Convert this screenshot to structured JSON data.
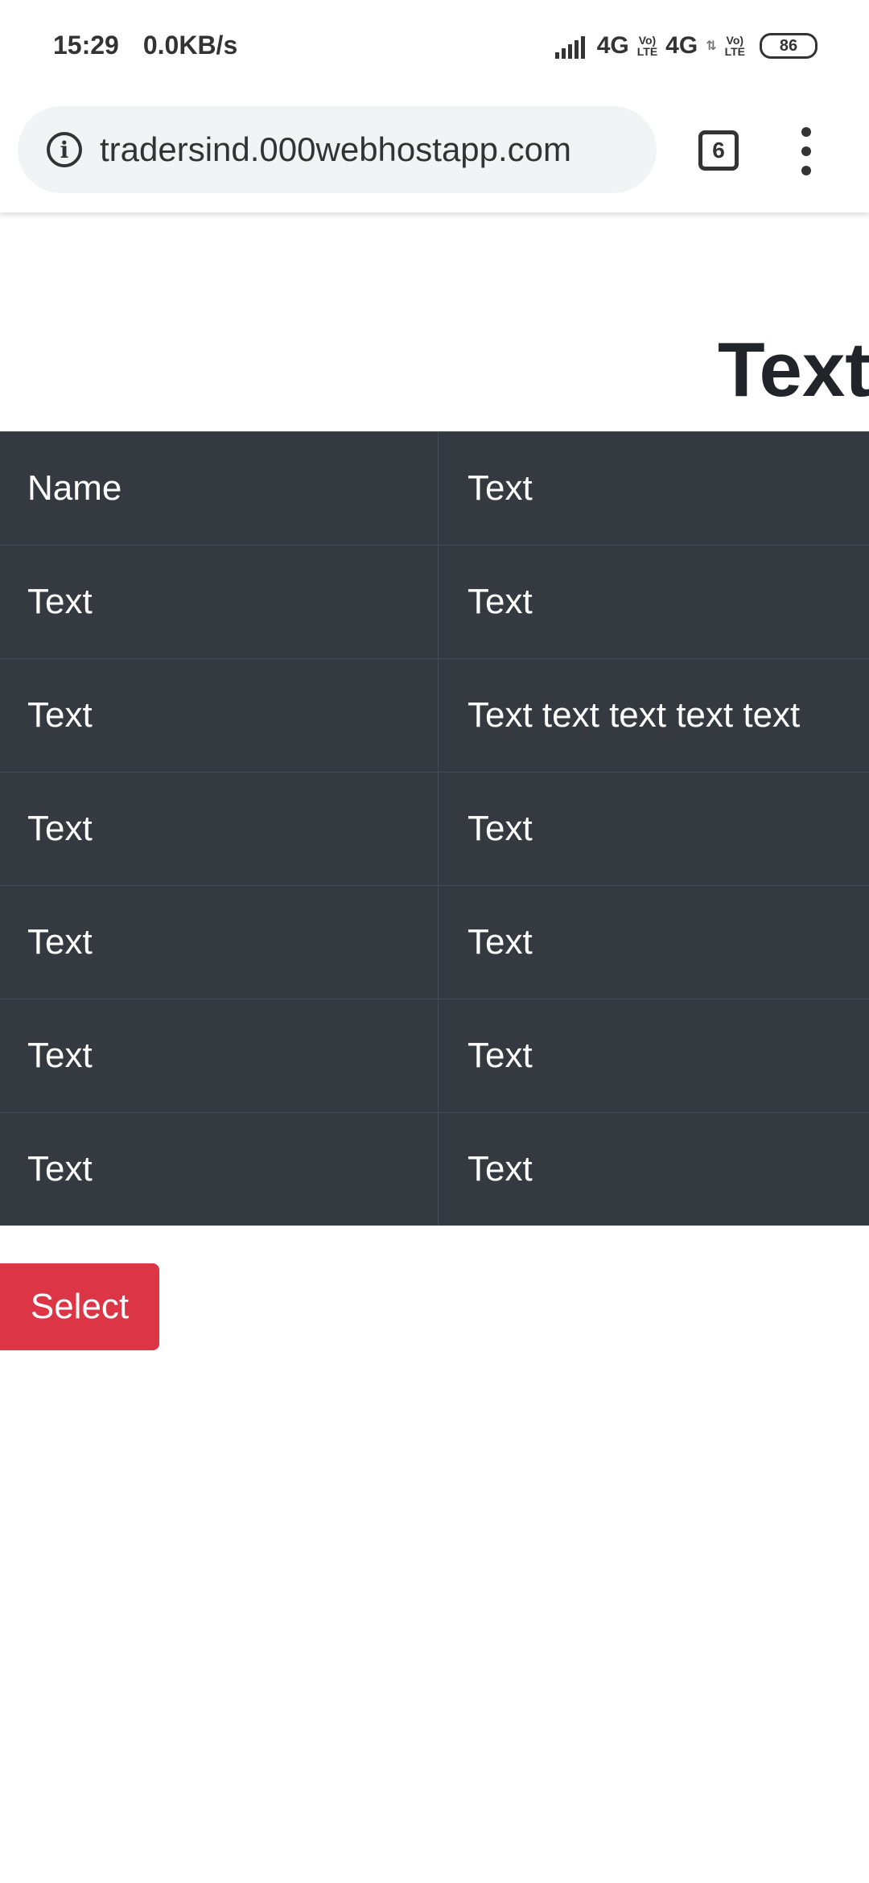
{
  "status_bar": {
    "time": "15:29",
    "net_speed": "0.0KB/s",
    "network1": "4G",
    "volte1": [
      "Vo)",
      "LTE"
    ],
    "network2": "4G",
    "volte2": [
      "Vo)",
      "LTE"
    ],
    "battery": "86"
  },
  "browser": {
    "url": "tradersind.000webhostapp.com",
    "tab_count": "6"
  },
  "page": {
    "heading": "Text:",
    "table_rows": [
      [
        "Name",
        "Text"
      ],
      [
        "Text",
        "Text"
      ],
      [
        "Text",
        "Text text text text text"
      ],
      [
        "Text",
        "Text"
      ],
      [
        "Text",
        "Text"
      ],
      [
        "Text",
        "Text"
      ],
      [
        "Text",
        "Text"
      ]
    ],
    "select_label": "Select",
    "colors": {
      "table_bg": "#343a40",
      "button_bg": "#dc3545"
    }
  }
}
